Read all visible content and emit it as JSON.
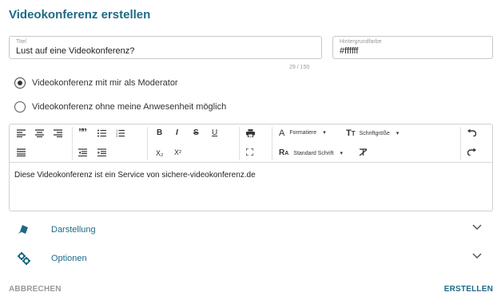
{
  "dialog": {
    "title": "Videokonferenz erstellen"
  },
  "fields": {
    "title": {
      "label": "Titel",
      "value": "Lust auf eine Videokonferenz?",
      "counter": "29 / 150"
    },
    "background": {
      "label": "Hintergrundfarbe",
      "value": "#ffffff"
    }
  },
  "options": {
    "radio1": {
      "label": "Videokonferenz mit mir als Moderator",
      "checked": true
    },
    "radio2": {
      "label": "Videokonferenz ohne meine Anwesenheit möglich",
      "checked": false
    }
  },
  "editor": {
    "toolbar": {
      "bold": "B",
      "italic": "I",
      "strike": "S",
      "underline": "U",
      "format_label": "Formatiere",
      "fontsize_label": "Schriftgröße",
      "font_label": "Standard Schrift",
      "quote": "””",
      "subscript": "X₂",
      "superscript": "X²"
    },
    "content": "Diese Videokonferenz ist ein Service von sichere-videokonferenz.de"
  },
  "sections": [
    {
      "label": "Darstellung",
      "icon": "paint-brush-icon"
    },
    {
      "label": "Optionen",
      "icon": "gears-icon"
    }
  ],
  "actions": {
    "cancel": "ABBRECHEN",
    "create": "ERSTELLEN"
  },
  "colors": {
    "accent": "#1e6a86",
    "muted": "#999999",
    "border": "#c8c8c8"
  }
}
